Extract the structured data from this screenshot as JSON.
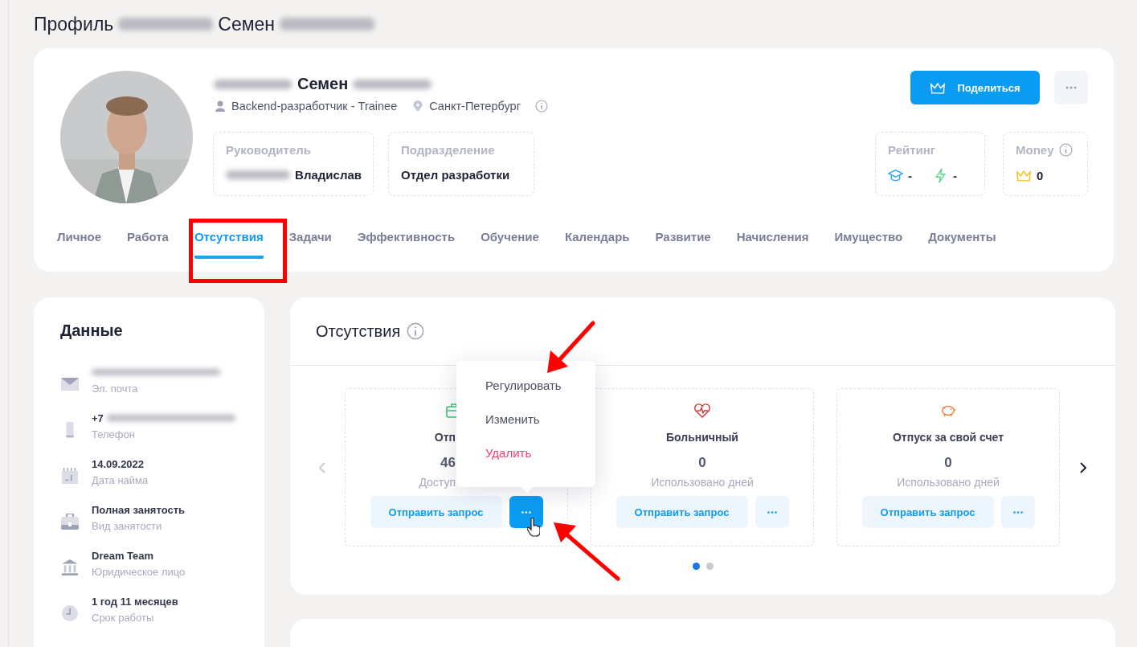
{
  "page_title": [
    {
      "kind": "text",
      "text": "Профиль"
    },
    {
      "kind": "redacted"
    },
    {
      "kind": "text",
      "text": "Семен"
    },
    {
      "kind": "redacted"
    }
  ],
  "profile": {
    "name": [
      {
        "kind": "redacted"
      },
      {
        "kind": "text",
        "text": "Семен"
      },
      {
        "kind": "redacted"
      }
    ],
    "role": "Backend-разработчик  - Trainee",
    "city": "Санкт-Петербург",
    "share_button": "Поделиться",
    "info_boxes": [
      {
        "label": "Руководитель",
        "value": [
          {
            "kind": "redacted"
          },
          {
            "kind": "text",
            "text": "Владислав"
          }
        ]
      },
      {
        "label": "Подразделение",
        "value": [
          {
            "kind": "text",
            "text": "Отдел разработки"
          }
        ]
      }
    ],
    "rating": {
      "label": "Рейтинг",
      "items": [
        {
          "kind": "education",
          "value": "-"
        },
        {
          "kind": "energy",
          "value": "-"
        }
      ]
    },
    "money": {
      "label": "Money",
      "value": "0"
    }
  },
  "tabs": [
    {
      "label": "Личное",
      "selected": false
    },
    {
      "label": "Работа",
      "selected": false
    },
    {
      "label": "Отсутствия",
      "selected": true
    },
    {
      "label": "Задачи",
      "selected": false
    },
    {
      "label": "Эффективность",
      "selected": false
    },
    {
      "label": "Обучение",
      "selected": false
    },
    {
      "label": "Календарь",
      "selected": false
    },
    {
      "label": "Развитие",
      "selected": false
    },
    {
      "label": "Начисления",
      "selected": false
    },
    {
      "label": "Имущество",
      "selected": false
    },
    {
      "label": "Документы",
      "selected": false
    }
  ],
  "data_panel": {
    "title": "Данные",
    "items": [
      {
        "kind": "email",
        "value": [
          {
            "kind": "redacted"
          }
        ],
        "label": "Эл. почта"
      },
      {
        "kind": "phone",
        "value": [
          {
            "kind": "text",
            "text": "+7"
          },
          {
            "kind": "redacted"
          }
        ],
        "label": "Телефон"
      },
      {
        "kind": "calendar",
        "value": [
          {
            "kind": "text",
            "text": "14.09.2022"
          }
        ],
        "label": "Дата найма"
      },
      {
        "kind": "briefcase",
        "value": [
          {
            "kind": "text",
            "text": "Полная занятость"
          }
        ],
        "label": "Вид занятости"
      },
      {
        "kind": "bank",
        "value": [
          {
            "kind": "text",
            "text": "Dream Team"
          }
        ],
        "label": "Юридическое лицо"
      },
      {
        "kind": "clock",
        "value": [
          {
            "kind": "text",
            "text": "1 год 11 месяцев"
          }
        ],
        "label": "Срок работы"
      }
    ]
  },
  "absences": {
    "title": "Отсутствия",
    "prev_enabled": false,
    "next_enabled": true,
    "cards": [
      {
        "kind": "vacation",
        "title": "Отп",
        "count": "46",
        "caption": "Доступ",
        "button": "Отправить запрос",
        "menu_open": true
      },
      {
        "kind": "sick",
        "title": "Больничный",
        "count": "0",
        "caption": "Использовано дней",
        "button": "Отправить запрос",
        "menu_open": false
      },
      {
        "kind": "unpaid",
        "title": "Отпуск за свой счет",
        "count": "0",
        "caption": "Использовано дней",
        "button": "Отправить запрос",
        "menu_open": false
      }
    ],
    "menu": [
      {
        "label": "Регулировать",
        "kind": "normal"
      },
      {
        "label": "Изменить",
        "kind": "normal"
      },
      {
        "label": "Удалить",
        "kind": "danger"
      }
    ],
    "pages": [
      {
        "selected": true
      },
      {
        "selected": false
      }
    ]
  }
}
